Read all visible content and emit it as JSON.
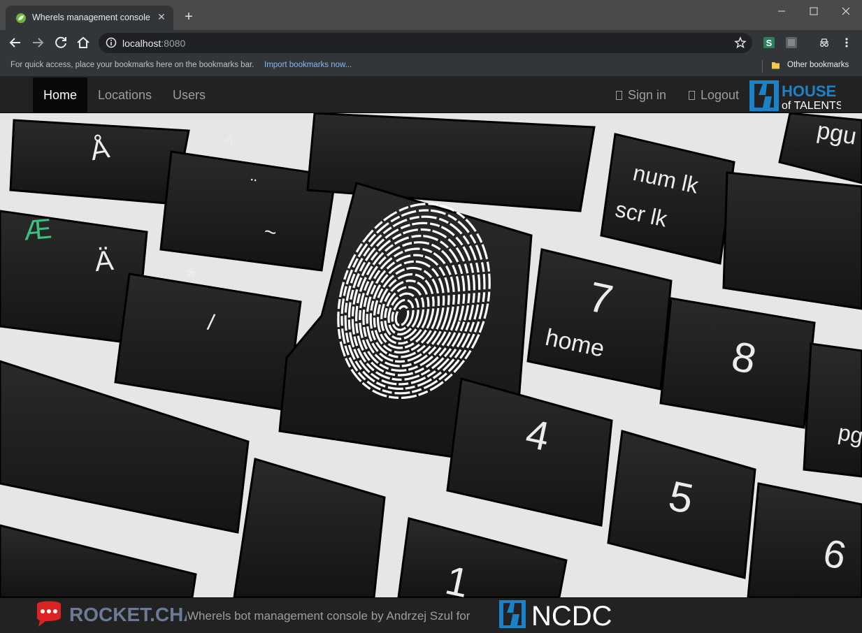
{
  "browser": {
    "tab_title": "Wherels management console",
    "url_host": "localhost",
    "url_port": ":8080",
    "bookmarks_hint": "For quick access, place your bookmarks here on the bookmarks bar.",
    "import_link": "Import bookmarks now...",
    "other_bookmarks": "Other bookmarks",
    "icons": [
      "back-icon",
      "forward-icon",
      "reload-icon",
      "home-icon",
      "info-icon",
      "star-icon",
      "menu-icon"
    ]
  },
  "navbar": {
    "items": [
      {
        "label": "Home",
        "active": true
      },
      {
        "label": "Locations",
        "active": false
      },
      {
        "label": "Users",
        "active": false
      }
    ],
    "sign_in": "Sign in",
    "logout": "Logout",
    "brand_logo": {
      "line1": "HOUSE",
      "line2": "of TALENTS"
    }
  },
  "hero": {
    "key_labels": [
      "Å",
      "^",
      "¨",
      "~",
      "Æ",
      "Ä",
      "*",
      "/",
      "num lk",
      "scr lk",
      "7",
      "home",
      "8",
      "4",
      "5",
      "6",
      "1",
      "pgu",
      "pg"
    ]
  },
  "footer": {
    "rocket_logo_text": "ROCKET.CHAT",
    "text": "Wherels bot management console by Andrzej Szul for",
    "ncdc_logo_text": "NCDC"
  },
  "colors": {
    "navbar_bg": "#222222",
    "active_nav_bg": "#080808",
    "brand_blue": "#1c82c8",
    "rocket_red": "#db2323"
  }
}
